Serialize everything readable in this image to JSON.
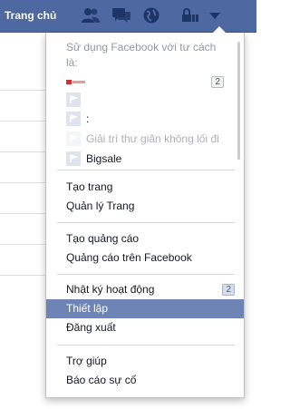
{
  "topbar": {
    "home_label": "Trang chủ",
    "icons": [
      "friend-requests-icon",
      "messages-icon",
      "notifications-globe-icon",
      "privacy-lock-icon",
      "settings-caret-icon"
    ]
  },
  "menu": {
    "use_as_label": "Sử dụng Facebook với tư cách là:",
    "pages": [
      {
        "label": "",
        "badge": "2",
        "logo": "brand-logo"
      },
      {
        "label": ""
      },
      {
        "label": ":"
      },
      {
        "label": "Giải trí thư giãn không lối đi"
      },
      {
        "label": "Bigsale"
      }
    ],
    "section_pages": [
      "Tạo trang",
      "Quản lý Trang"
    ],
    "section_ads": [
      "Tạo quảng cáo",
      "Quảng cáo trên Facebook"
    ],
    "section_account": {
      "activity_log": "Nhật ký hoạt động",
      "activity_badge": "2",
      "settings": "Thiết lập",
      "logout": "Đăng xuất"
    },
    "section_help": [
      "Trợ giúp",
      "Báo cáo sự cố"
    ]
  },
  "colors": {
    "topbar": "#4e69a2",
    "selected_item": "#6d84b4"
  }
}
